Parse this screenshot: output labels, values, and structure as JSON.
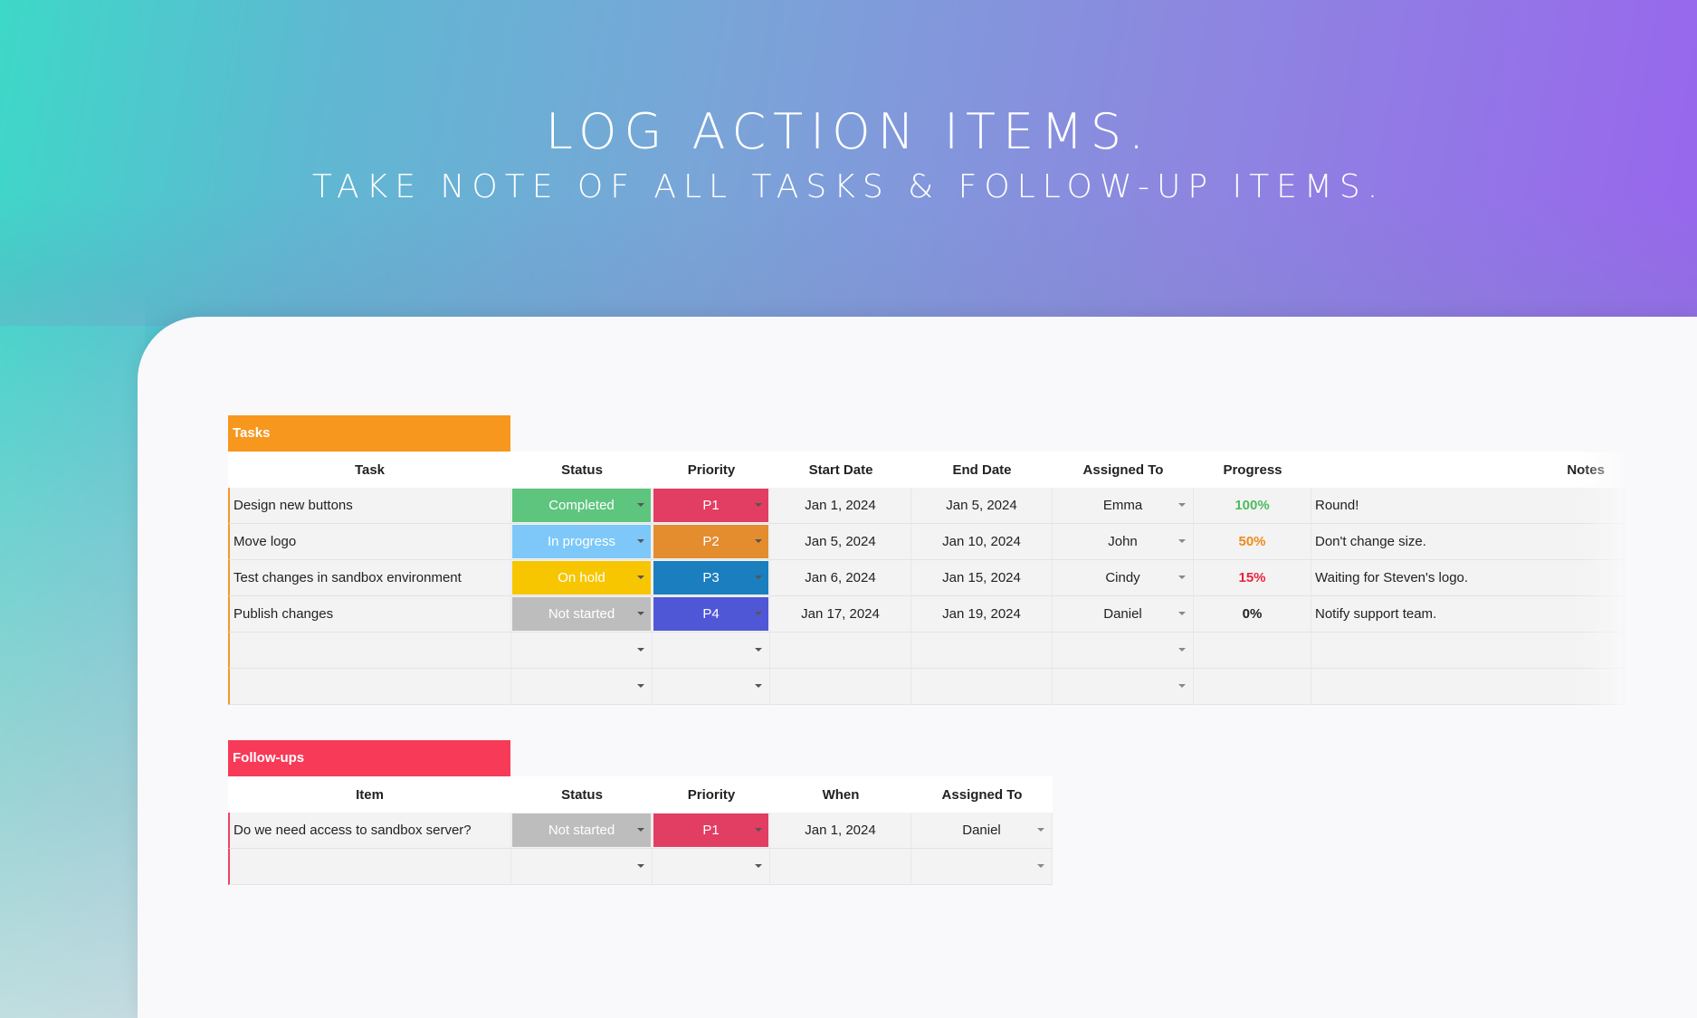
{
  "hero": {
    "title": "LOG ACTION ITEMS.",
    "subtitle": "TAKE NOTE OF ALL TASKS & FOLLOW-UP ITEMS."
  },
  "colors": {
    "tasks_tab": "#f7971e",
    "followups_tab": "#f73a58",
    "completed": "#5ec57e",
    "in_progress": "#7dc8f8",
    "on_hold": "#f7c600",
    "not_started": "#bdbdbd",
    "p1": "#e23d63",
    "p2": "#e38d2f",
    "p3": "#1a7ebf",
    "p4": "#5057d7"
  },
  "tasks": {
    "tab_label": "Tasks",
    "headers": {
      "task": "Task",
      "status": "Status",
      "priority": "Priority",
      "start": "Start Date",
      "end": "End Date",
      "assigned": "Assigned To",
      "progress": "Progress",
      "notes": "Notes"
    },
    "rows": [
      {
        "task": "Design new buttons",
        "status": "Completed",
        "priority": "P1",
        "start": "Jan 1, 2024",
        "end": "Jan 5, 2024",
        "assigned": "Emma",
        "progress": "100%",
        "notes": "Round!"
      },
      {
        "task": "Move logo",
        "status": "In progress",
        "priority": "P2",
        "start": "Jan 5, 2024",
        "end": "Jan 10, 2024",
        "assigned": "John",
        "progress": "50%",
        "notes": "Don't change size."
      },
      {
        "task": "Test changes in sandbox environment",
        "status": "On hold",
        "priority": "P3",
        "start": "Jan 6, 2024",
        "end": "Jan 15, 2024",
        "assigned": "Cindy",
        "progress": "15%",
        "notes": "Waiting for Steven's logo."
      },
      {
        "task": "Publish changes",
        "status": "Not started",
        "priority": "P4",
        "start": "Jan 17, 2024",
        "end": "Jan 19, 2024",
        "assigned": "Daniel",
        "progress": "0%",
        "notes": "Notify support team."
      }
    ]
  },
  "followups": {
    "tab_label": "Follow-ups",
    "headers": {
      "item": "Item",
      "status": "Status",
      "priority": "Priority",
      "when": "When",
      "assigned": "Assigned To"
    },
    "rows": [
      {
        "item": "Do we need access to sandbox server?",
        "status": "Not started",
        "priority": "P1",
        "when": "Jan 1, 2024",
        "assigned": "Daniel"
      }
    ]
  }
}
